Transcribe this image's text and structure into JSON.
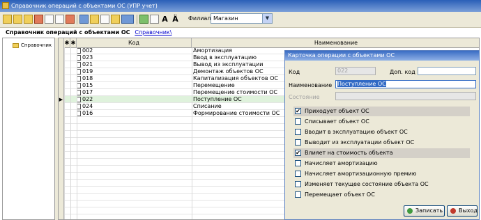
{
  "window": {
    "title": "Справочник операций с объектами ОС (УПР учет)"
  },
  "toolbar": {
    "font_glyph_1": "A",
    "font_glyph_2": "Ä",
    "filial_label": "Филиал",
    "filial_value": "Магазин"
  },
  "page": {
    "heading": "Справочник операций с объектами ОС",
    "breadcrumb": "Справочник\\"
  },
  "tree": {
    "items": [
      {
        "label": "Справочник"
      }
    ]
  },
  "grid": {
    "columns": {
      "mark": "✱",
      "code": "Код",
      "name": "Наименование"
    },
    "rows": [
      {
        "code": "002",
        "name": "Амортизация"
      },
      {
        "code": "023",
        "name": "Ввод в эксплуатацию"
      },
      {
        "code": "021",
        "name": "Вывод из эксплуатации"
      },
      {
        "code": "019",
        "name": "Демонтаж объектов ОС"
      },
      {
        "code": "018",
        "name": "Капитализация объектов ОС"
      },
      {
        "code": "015",
        "name": "Перемещение"
      },
      {
        "code": "017",
        "name": "Перемещение стоимости ОС"
      },
      {
        "code": "022",
        "name": "Поступление ОС",
        "selected": true
      },
      {
        "code": "024",
        "name": "Списание"
      },
      {
        "code": "016",
        "name": "Формирование стоимости ОС"
      }
    ],
    "current_row_marker": "▶",
    "selected_row_color": "#dff2dc"
  },
  "card": {
    "title": "Карточка операции с объектами ОС",
    "code_label": "Код",
    "code_value": "022",
    "extra_code_label": "Доп. код",
    "extra_code_value": "",
    "name_label": "Наименование",
    "name_value": "Поступление ОС",
    "state_label": "Состояние",
    "state_value": "",
    "options": [
      {
        "label": "Приходует объект ОС",
        "checked": true
      },
      {
        "label": "Списывает объект ОС",
        "checked": false
      },
      {
        "label": "Вводит в эксплуатацию объект ОС",
        "checked": false
      },
      {
        "label": "Выводит из эксплуатации объект ОС",
        "checked": false
      },
      {
        "label": "Влияет на стоимость объекта",
        "checked": true
      },
      {
        "label": "Начисляет амортизацию",
        "checked": false
      },
      {
        "label": "Начисляет амортизационную премию",
        "checked": false
      },
      {
        "label": "Изменяет текущее состояние объекта ОС",
        "checked": false
      },
      {
        "label": "Перемещает объект ОС",
        "checked": false
      }
    ],
    "check_glyph": "✔",
    "save_label": "Записать",
    "exit_label": "Выход",
    "save_icon_color": "#3f9a3f",
    "exit_icon_color": "#c0392b"
  },
  "colors": {
    "titlebar": "#2a5fb8",
    "accent": "#316ac5"
  }
}
